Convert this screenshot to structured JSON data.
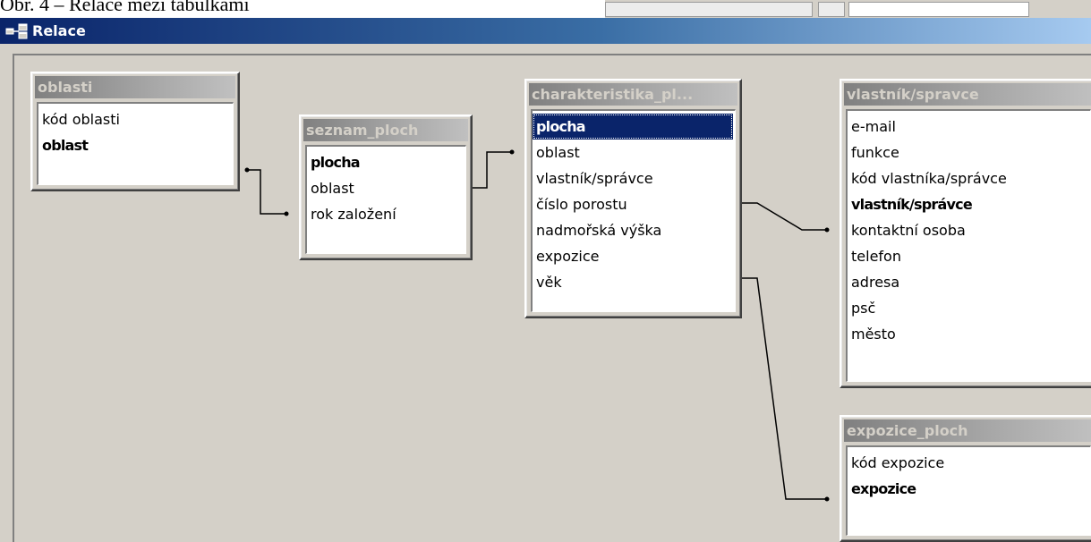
{
  "document": {
    "caption": "Obr. 4 – Relace mezi tabulkami"
  },
  "window": {
    "title": "Relace",
    "icon": "relationships-icon"
  },
  "tables": [
    {
      "name": "oblasti",
      "fields": [
        {
          "label": "kód oblasti",
          "key": false
        },
        {
          "label": "oblast",
          "key": true
        }
      ]
    },
    {
      "name": "seznam_ploch",
      "fields": [
        {
          "label": "plocha",
          "key": true
        },
        {
          "label": "oblast",
          "key": false
        },
        {
          "label": "rok založení",
          "key": false
        }
      ]
    },
    {
      "name": "charakteristika_pl...",
      "fields": [
        {
          "label": "plocha",
          "key": true,
          "selected": true
        },
        {
          "label": "oblast",
          "key": false
        },
        {
          "label": "vlastník/správce",
          "key": false
        },
        {
          "label": "číslo porostu",
          "key": false
        },
        {
          "label": "nadmořská výška",
          "key": false
        },
        {
          "label": "expozice",
          "key": false
        },
        {
          "label": "věk",
          "key": false
        }
      ]
    },
    {
      "name": "vlastník/spravce",
      "fields": [
        {
          "label": "e-mail",
          "key": false
        },
        {
          "label": "funkce",
          "key": false
        },
        {
          "label": "kód vlastníka/správce",
          "key": false
        },
        {
          "label": "vlastník/správce",
          "key": true
        },
        {
          "label": "kontaktní osoba",
          "key": false
        },
        {
          "label": "telefon",
          "key": false
        },
        {
          "label": "adresa",
          "key": false
        },
        {
          "label": "psč",
          "key": false
        },
        {
          "label": "město",
          "key": false
        }
      ]
    },
    {
      "name": "expozice_ploch",
      "fields": [
        {
          "label": "kód expozice",
          "key": false
        },
        {
          "label": "expozice",
          "key": true
        }
      ]
    }
  ],
  "colors": {
    "titlebar_start": "#0a246a",
    "titlebar_end": "#a6caf0",
    "selection": "#0a246a",
    "window_bg": "#d4d0c8"
  }
}
